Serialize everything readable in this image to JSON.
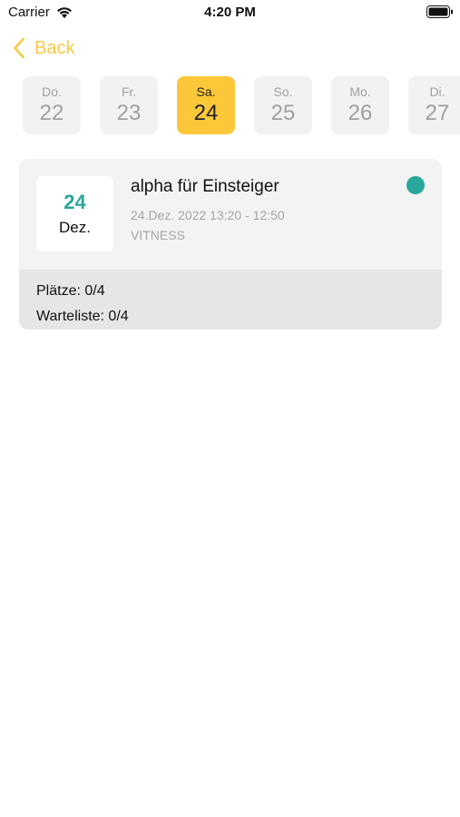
{
  "status_bar": {
    "carrier": "Carrier",
    "time": "4:20 PM"
  },
  "nav": {
    "back_label": "Back"
  },
  "days": [
    {
      "name": "Do.",
      "num": "22",
      "selected": false
    },
    {
      "name": "Fr.",
      "num": "23",
      "selected": false
    },
    {
      "name": "Sa.",
      "num": "24",
      "selected": true
    },
    {
      "name": "So.",
      "num": "25",
      "selected": false
    },
    {
      "name": "Mo.",
      "num": "26",
      "selected": false
    },
    {
      "name": "Di.",
      "num": "27",
      "selected": false
    }
  ],
  "event": {
    "date_day": "24",
    "date_month": "Dez.",
    "title": "alpha für Einsteiger",
    "datetime": "24.Dez. 2022 13:20 - 12:50",
    "location": "VITNESS",
    "places": "Plätze: 0/4",
    "waitlist": "Warteliste: 0/4",
    "status_color": "#2aa79b"
  },
  "colors": {
    "accent": "#f7c948",
    "selected_day": "#fcc83a",
    "teal": "#2aa79b"
  }
}
